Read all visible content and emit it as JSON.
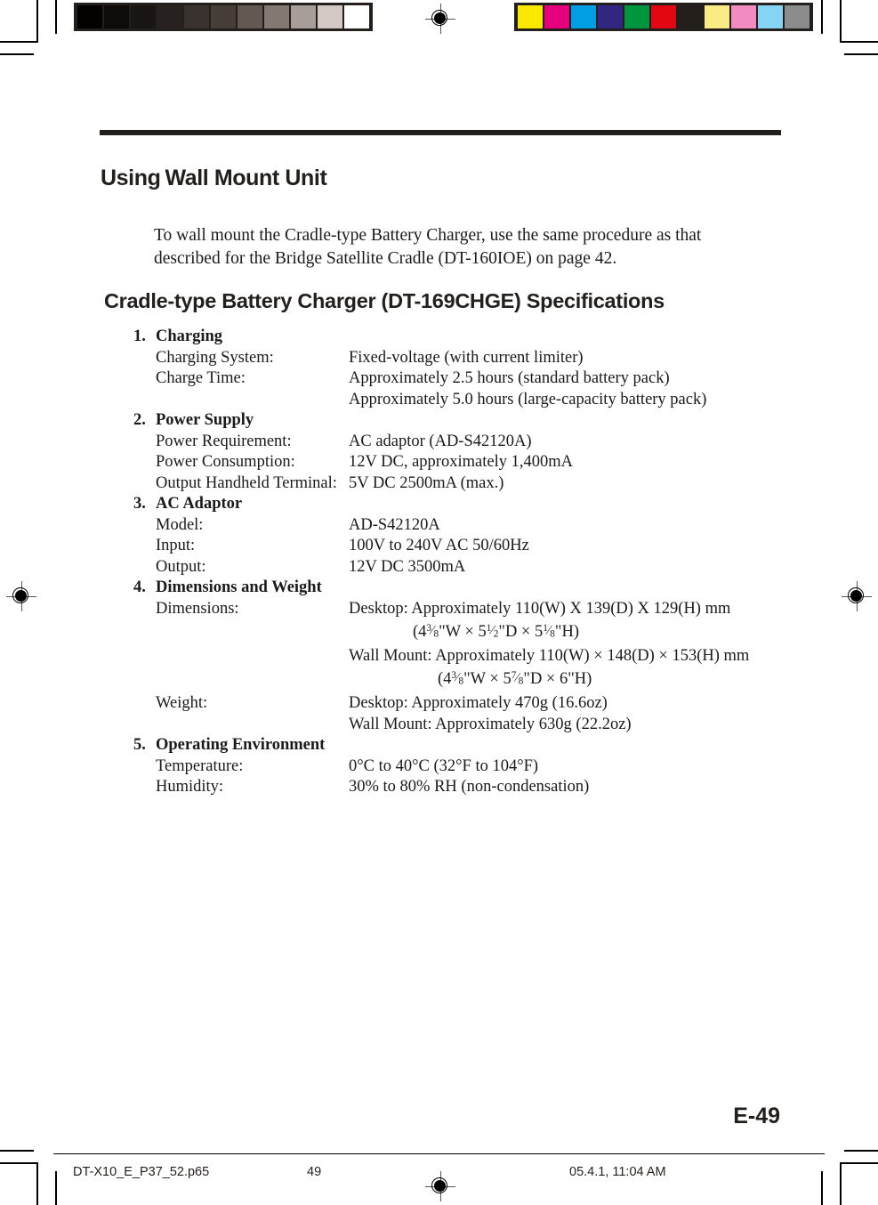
{
  "document": {
    "page_label": "E-49",
    "heading_1_a": "Using",
    "heading_1_b": "Wall Mount Unit",
    "intro_paragraph": "To wall mount the Cradle-type Battery Charger, use the same procedure as that described for the Bridge Satellite Cradle (DT-160IOE) on page 42.",
    "heading_2": "Cradle-type Battery Charger (DT-169CHGE) Specifications"
  },
  "specs": [
    {
      "number": "1.",
      "title": "Charging",
      "rows": [
        {
          "label": "Charging System:",
          "value": "Fixed-voltage (with current limiter)"
        },
        {
          "label": "Charge Time:",
          "value": "Approximately 2.5 hours (standard battery pack)"
        },
        {
          "label": "",
          "value": "Approximately 5.0 hours (large-capacity battery pack)"
        }
      ]
    },
    {
      "number": "2.",
      "title": "Power Supply",
      "rows": [
        {
          "label": "Power Requirement:",
          "value": "AC adaptor (AD-S42120A)"
        },
        {
          "label": "Power Consumption:",
          "value": "12V DC, approximately 1,400mA"
        },
        {
          "label": "Output Handheld Terminal:",
          "value": "5V DC 2500mA (max.)"
        }
      ]
    },
    {
      "number": "3.",
      "title": "AC Adaptor",
      "rows": [
        {
          "label": "Model:",
          "value": "AD-S42120A"
        },
        {
          "label": "Input:",
          "value": "100V to 240V AC 50/60Hz"
        },
        {
          "label": "Output:",
          "value": "12V DC 3500mA"
        }
      ]
    },
    {
      "number": "4.",
      "title": "Dimensions and Weight",
      "rows": [
        {
          "label": "Dimensions:",
          "value": "Desktop: Approximately 110(W) X 139(D) X 129(H) mm"
        },
        {
          "label": "",
          "value": "Wall Mount: Approximately 110(W) × 148(D) × 153(H) mm"
        },
        {
          "label": "Weight:",
          "value": "Desktop: Approximately 470g (16.6oz)"
        },
        {
          "label": "",
          "value": "Wall Mount: Approximately 630g (22.2oz)"
        }
      ]
    },
    {
      "number": "5.",
      "title": "Operating Environment",
      "rows": [
        {
          "label": "Temperature:",
          "value": "0°C to 40°C (32°F to 104°F)"
        },
        {
          "label": "Humidity:",
          "value": "30% to 80% RH (non-condensation)"
        }
      ]
    }
  ],
  "dimension_fractions": {
    "desktop": {
      "open": "(4",
      "f1_n": "3",
      "f1_d": "8",
      "mid1": "\"W × 5",
      "f2_n": "1",
      "f2_d": "2",
      "mid2": "\"D ×  5",
      "f3_n": "1",
      "f3_d": "8",
      "close": "\"H)"
    },
    "wall_mount": {
      "open": "(4",
      "f1_n": "3",
      "f1_d": "8",
      "mid1": "\"W × 5",
      "f2_n": "7",
      "f2_d": "8",
      "close": "\"D ×  6\"H)"
    }
  },
  "print_marks": {
    "grayscale_patches": [
      "#030100",
      "#0e0b09",
      "#191512",
      "#272220",
      "#3a322f",
      "#473e3a",
      "#645853",
      "#847873",
      "#a79d99",
      "#d3c8c4",
      "#ffffff"
    ],
    "color_patches": [
      "#fbe800",
      "#e6007e",
      "#009fe3",
      "#312783",
      "#009640",
      "#e30613",
      "#231f1d",
      "#fbeb84",
      "#f28cc0",
      "#85d4f3",
      "#8c8c8c"
    ]
  },
  "footer": {
    "file_name": "DT-X10_E_P37_52.p65",
    "page_number": "49",
    "timestamp": "05.4.1, 11:04 AM"
  }
}
